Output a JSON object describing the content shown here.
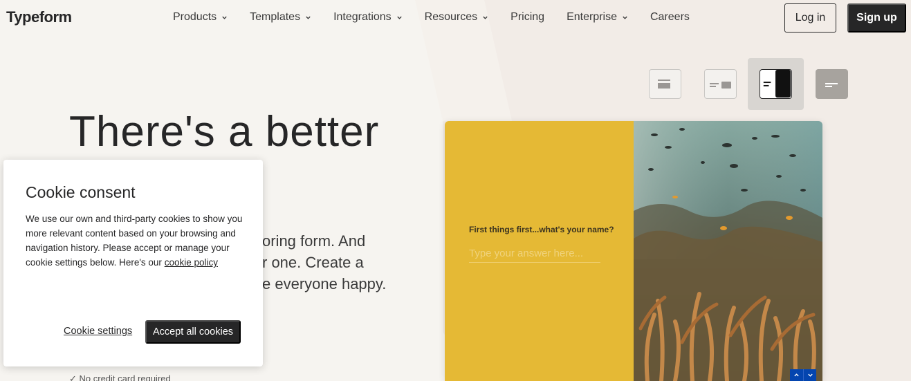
{
  "header": {
    "logo": "Typeform",
    "nav": [
      {
        "label": "Products",
        "dropdown": true
      },
      {
        "label": "Templates",
        "dropdown": true
      },
      {
        "label": "Integrations",
        "dropdown": true
      },
      {
        "label": "Resources",
        "dropdown": true
      },
      {
        "label": "Pricing",
        "dropdown": false
      },
      {
        "label": "Enterprise",
        "dropdown": true
      },
      {
        "label": "Careers",
        "dropdown": false
      }
    ],
    "login_label": "Log in",
    "signup_label": "Sign up"
  },
  "hero": {
    "title": "There's a better",
    "subtitle_lines": [
      "oring form. And",
      "r one. Create a",
      "e everyone happy."
    ],
    "note": "✓  No credit card required"
  },
  "layout_switcher": {
    "options": [
      "layout-classic-icon",
      "layout-split-icon",
      "layout-wallpaper-icon",
      "layout-minimal-icon"
    ],
    "active_index": 2
  },
  "preview": {
    "question": "First things first...what's your name?",
    "input_placeholder": "Type your answer here...",
    "accent_color": "#e5b935",
    "nav_color": "#0445af"
  },
  "cookie": {
    "title": "Cookie consent",
    "body": "We use our own and third-party cookies to show you more relevant content based on your browsing and navigation history. Please accept or manage your cookie settings below. Here's our",
    "policy_link": "cookie policy",
    "settings_label": "Cookie settings",
    "accept_label": "Accept all cookies"
  }
}
